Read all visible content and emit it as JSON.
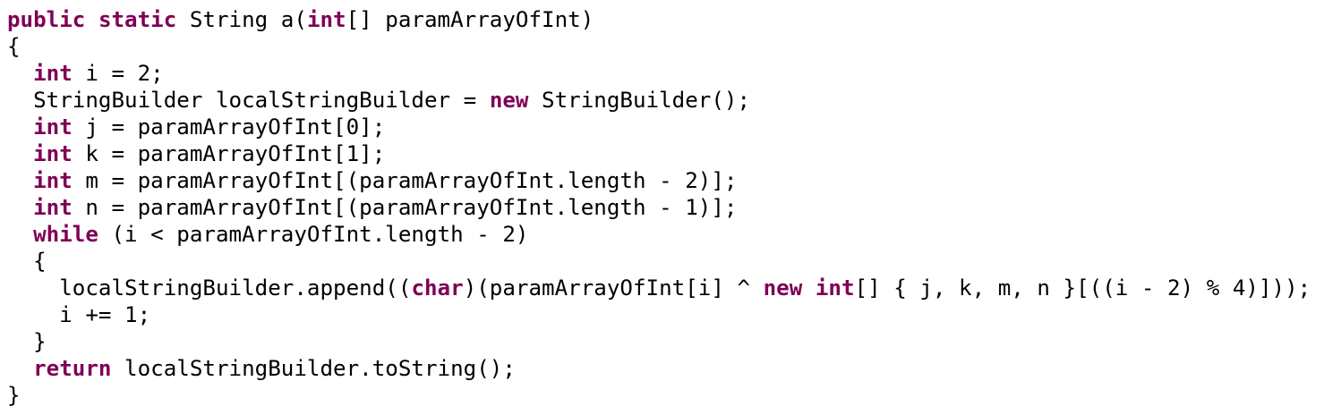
{
  "colors": {
    "background": "#ffffff",
    "text": "#000000",
    "keyword": "#7f0055"
  },
  "code": {
    "lines": [
      [
        {
          "t": "kw",
          "s": "public"
        },
        {
          "s": " "
        },
        {
          "t": "kw",
          "s": "static"
        },
        {
          "s": " String a("
        },
        {
          "t": "kw",
          "s": "int"
        },
        {
          "s": "[] paramArrayOfInt)"
        }
      ],
      [
        {
          "s": "{"
        }
      ],
      [
        {
          "s": "  "
        },
        {
          "t": "kw",
          "s": "int"
        },
        {
          "s": " i = 2;"
        }
      ],
      [
        {
          "s": "  StringBuilder localStringBuilder = "
        },
        {
          "t": "kw",
          "s": "new"
        },
        {
          "s": " StringBuilder();"
        }
      ],
      [
        {
          "s": "  "
        },
        {
          "t": "kw",
          "s": "int"
        },
        {
          "s": " j = paramArrayOfInt[0];"
        }
      ],
      [
        {
          "s": "  "
        },
        {
          "t": "kw",
          "s": "int"
        },
        {
          "s": " k = paramArrayOfInt[1];"
        }
      ],
      [
        {
          "s": "  "
        },
        {
          "t": "kw",
          "s": "int"
        },
        {
          "s": " m = paramArrayOfInt[(paramArrayOfInt.length - 2)];"
        }
      ],
      [
        {
          "s": "  "
        },
        {
          "t": "kw",
          "s": "int"
        },
        {
          "s": " n = paramArrayOfInt[(paramArrayOfInt.length - 1)];"
        }
      ],
      [
        {
          "s": "  "
        },
        {
          "t": "kw",
          "s": "while"
        },
        {
          "s": " (i < paramArrayOfInt.length - 2)"
        }
      ],
      [
        {
          "s": "  {"
        }
      ],
      [
        {
          "s": "    localStringBuilder.append(("
        },
        {
          "t": "kw",
          "s": "char"
        },
        {
          "s": ")(paramArrayOfInt[i] ^ "
        },
        {
          "t": "kw",
          "s": "new"
        },
        {
          "s": " "
        },
        {
          "t": "kw",
          "s": "int"
        },
        {
          "s": "[] { j, k, m, n }[((i - 2) % 4)]));"
        }
      ],
      [
        {
          "s": "    i += 1;"
        }
      ],
      [
        {
          "s": "  }"
        }
      ],
      [
        {
          "s": "  "
        },
        {
          "t": "kw",
          "s": "return"
        },
        {
          "s": " localStringBuilder.toString();"
        }
      ],
      [
        {
          "s": "}"
        }
      ]
    ]
  }
}
